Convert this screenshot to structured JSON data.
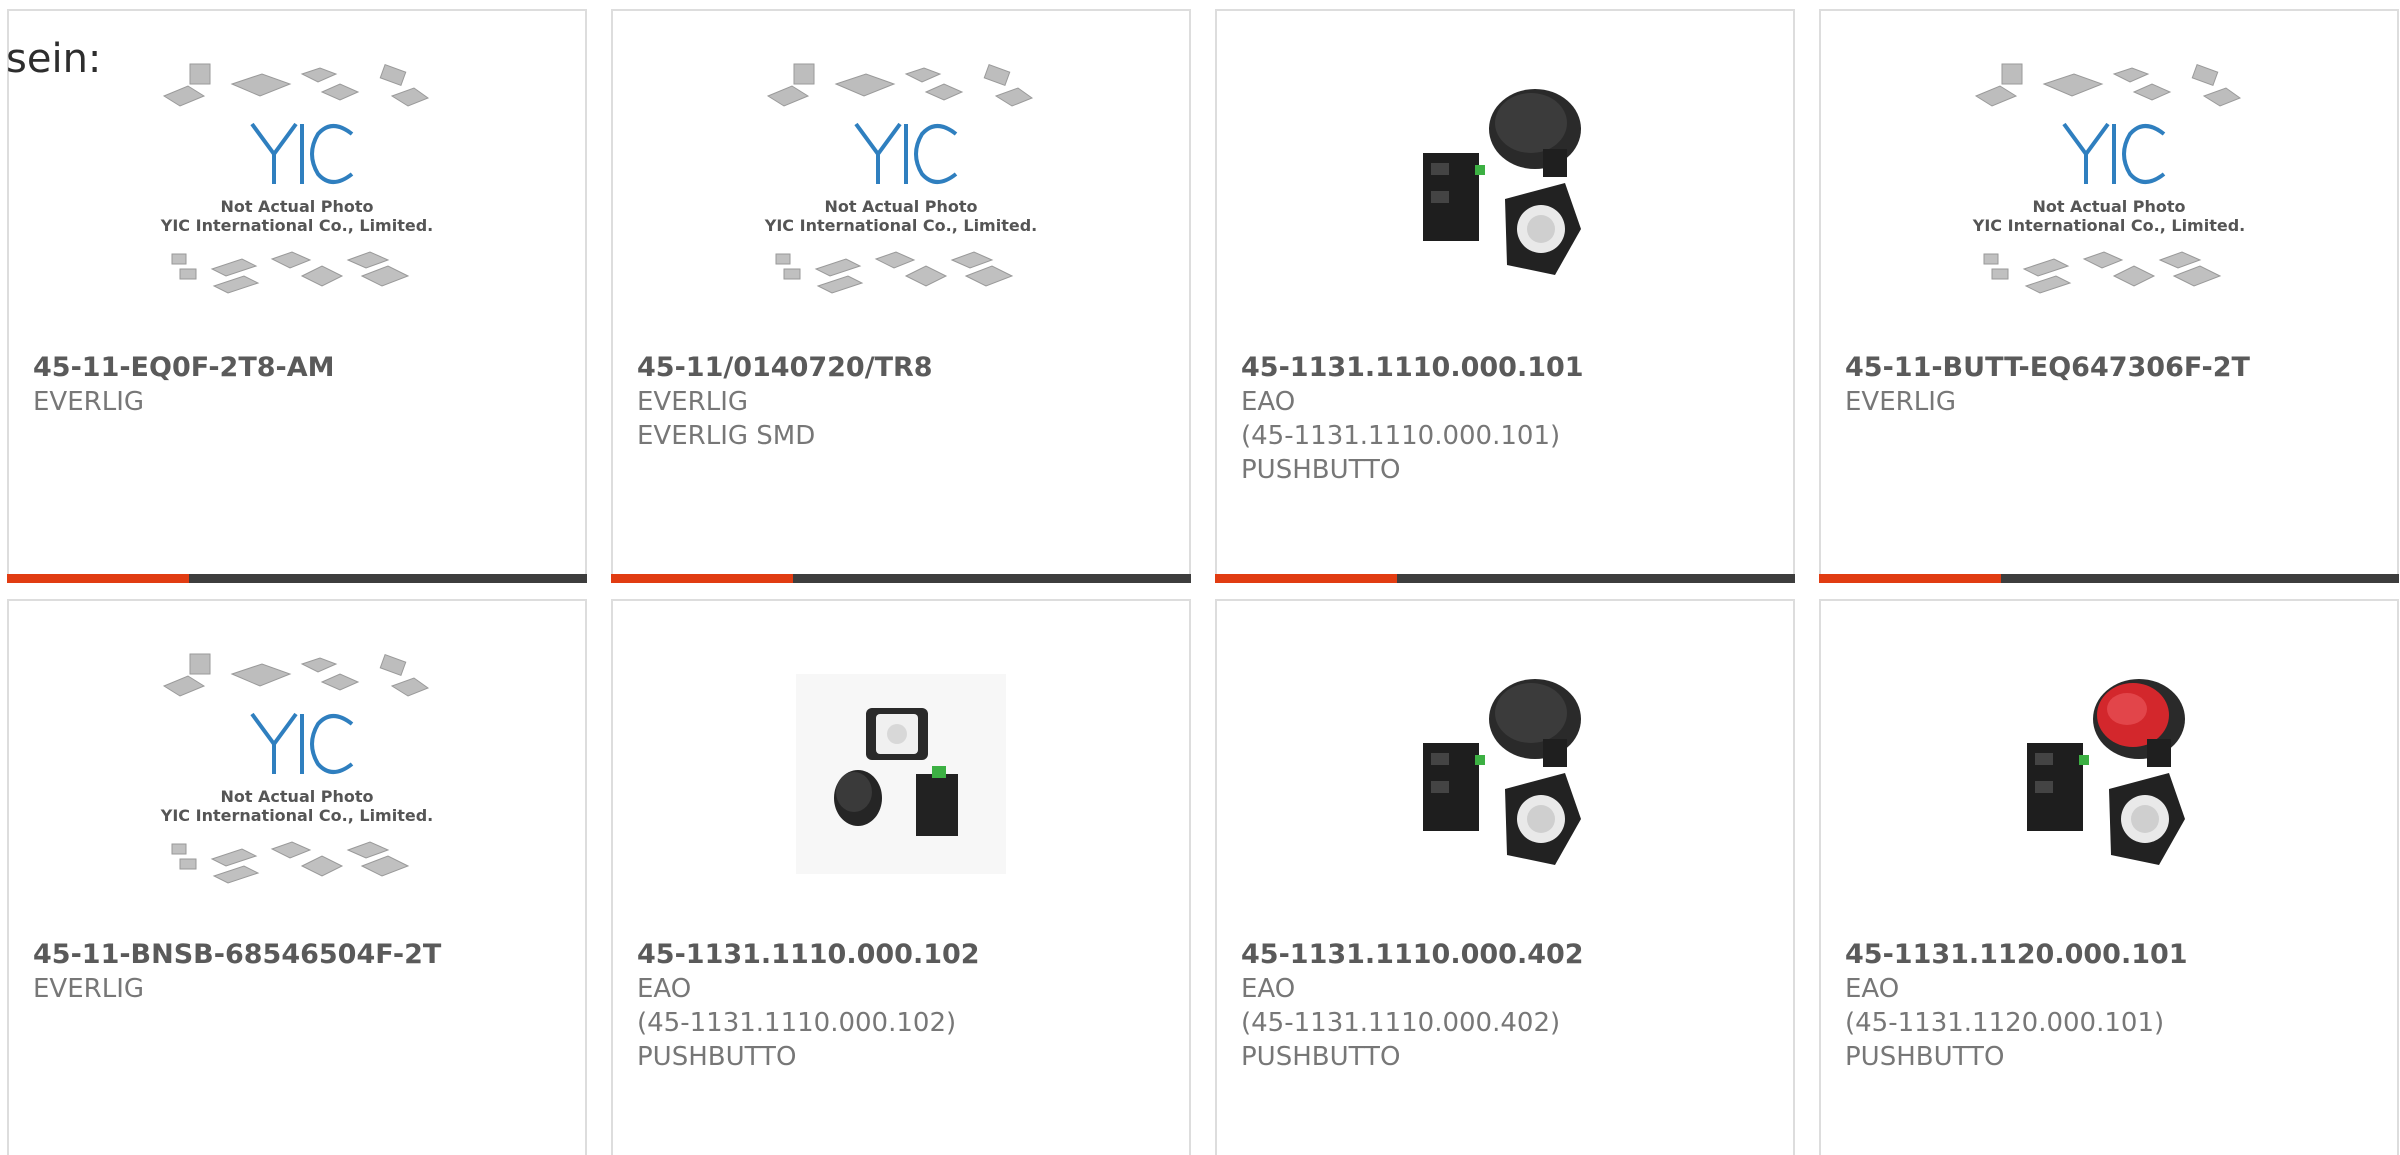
{
  "lead_text": "sein:",
  "colors": {
    "accent": "#e13c12",
    "bar": "#3d3d3d",
    "border": "#dddddd"
  },
  "products": [
    {
      "part_number": "45-11-EQ0F-2T8-AM",
      "lines": [
        "EVERLIG"
      ],
      "image": "placeholder-yic-icon"
    },
    {
      "part_number": "45-11/0140720/TR8",
      "lines": [
        "EVERLIG",
        "EVERLIG SMD"
      ],
      "image": "placeholder-yic-icon"
    },
    {
      "part_number": "45-1131.1110.000.101",
      "lines": [
        "EAO",
        "(45-1131.1110.000.101)",
        "PUSHBUTTO"
      ],
      "image": "pushbutton-black-icon"
    },
    {
      "part_number": "45-11-BUTT-EQ647306F-2T",
      "lines": [
        "EVERLIG"
      ],
      "image": "placeholder-yic-icon"
    },
    {
      "part_number": "45-11-BNSB-68546504F-2T",
      "lines": [
        "EVERLIG"
      ],
      "image": "placeholder-yic-icon"
    },
    {
      "part_number": "45-1131.1110.000.102",
      "lines": [
        "EAO",
        "(45-1131.1110.000.102)",
        "PUSHBUTTO"
      ],
      "image": "pushbutton-small-icon"
    },
    {
      "part_number": "45-1131.1110.000.402",
      "lines": [
        "EAO",
        "(45-1131.1110.000.402)",
        "PUSHBUTTO"
      ],
      "image": "pushbutton-black-icon"
    },
    {
      "part_number": "45-1131.1120.000.101",
      "lines": [
        "EAO",
        "(45-1131.1120.000.101)",
        "PUSHBUTTO"
      ],
      "image": "pushbutton-red-icon"
    }
  ],
  "placeholder": {
    "line1": "Not Actual Photo",
    "line2": "YIC International Co., Limited.",
    "logo": "YIC"
  }
}
